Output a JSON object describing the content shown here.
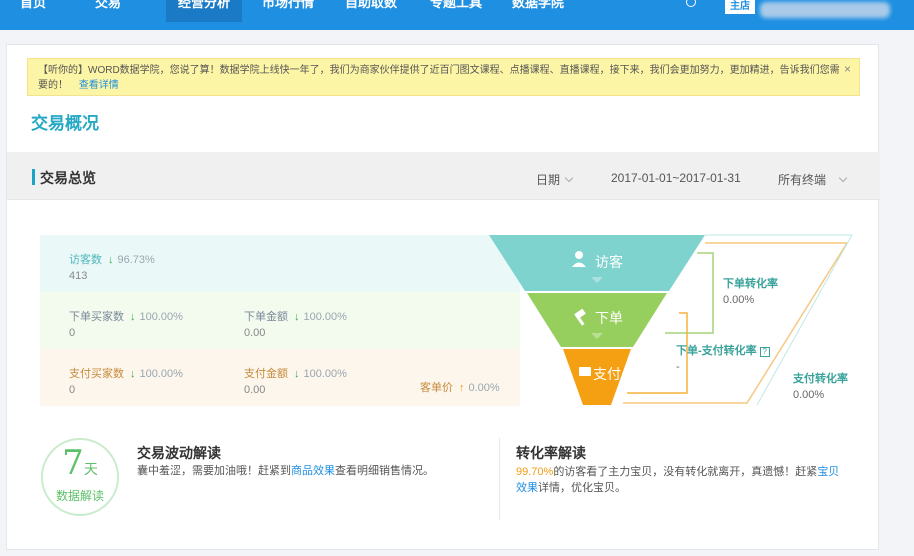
{
  "topnav": {
    "items": [
      "首页",
      "交易",
      "经营分析",
      "市场行情",
      "自助取数",
      "专题工具",
      "数据学院"
    ],
    "shop_badge": "主店"
  },
  "notice": {
    "text": "【听你的】WORD数据学院，您说了算！数据学院上线快一年了，我们为商家伙伴提供了近百门图文课程、点播课程、直播课程，接下来，我们会更加努力，更加精进，告诉我们您需要的！",
    "link": "查看详情",
    "close": "×"
  },
  "page_title": "交易概况",
  "section": {
    "title": "交易总览",
    "date_label": "日期",
    "date_range": "2017-01-01~2017-01-31",
    "terminal": "所有终端"
  },
  "funnel": {
    "visitors": {
      "label": "访客数",
      "change": "96.73%",
      "value": "413"
    },
    "order_buyers": {
      "label": "下单买家数",
      "change": "100.00%",
      "value": "0"
    },
    "order_amount": {
      "label": "下单金额",
      "change": "100.00%",
      "value": "0.00"
    },
    "pay_buyers": {
      "label": "支付买家数",
      "change": "100.00%",
      "value": "0"
    },
    "pay_amount": {
      "label": "支付金额",
      "change": "100.00%",
      "value": "0.00"
    },
    "unit_price": {
      "label": "客单价",
      "change": "0.00%"
    },
    "stages": [
      "访客",
      "下单",
      "支付"
    ],
    "stage_colors": [
      "#7fd3cf",
      "#97cf5f",
      "#f5a012"
    ],
    "order_conv": {
      "label": "下单转化率",
      "value": "0.00%"
    },
    "order_pay_conv": {
      "label": "下单-支付转化率",
      "value": "-"
    },
    "pay_conv": {
      "label": "支付转化率",
      "value": "0.00%"
    }
  },
  "insights": {
    "badge_num": "7",
    "badge_unit": "天",
    "badge_sub": "数据解读",
    "fluct_title": "交易波动解读",
    "fluct_text_a": "囊中羞涩，需要加油哦！赶紧到",
    "fluct_link": "商品效果",
    "fluct_text_b": "查看明细销售情况。",
    "conv_title": "转化率解读",
    "conv_pct": "99.70%",
    "conv_text_a": "的访客看了主力宝贝，没有转化就离开，真遗憾！赶紧",
    "conv_link": "宝贝效果",
    "conv_text_b": "详情，优化宝贝。"
  }
}
